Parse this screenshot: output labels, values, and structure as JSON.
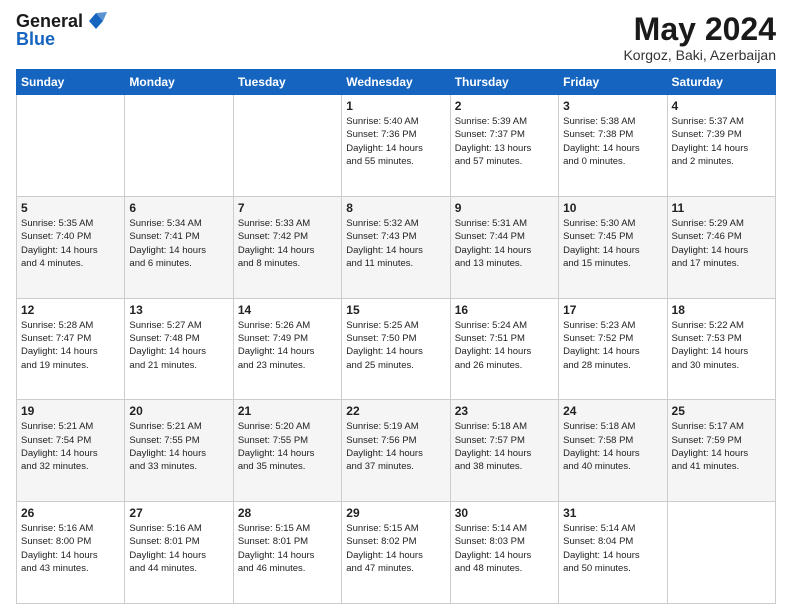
{
  "header": {
    "logo_general": "General",
    "logo_blue": "Blue",
    "month": "May 2024",
    "location": "Korgoz, Baki, Azerbaijan"
  },
  "weekdays": [
    "Sunday",
    "Monday",
    "Tuesday",
    "Wednesday",
    "Thursday",
    "Friday",
    "Saturday"
  ],
  "rows": [
    [
      {
        "day": "",
        "info": ""
      },
      {
        "day": "",
        "info": ""
      },
      {
        "day": "",
        "info": ""
      },
      {
        "day": "1",
        "info": "Sunrise: 5:40 AM\nSunset: 7:36 PM\nDaylight: 14 hours\nand 55 minutes."
      },
      {
        "day": "2",
        "info": "Sunrise: 5:39 AM\nSunset: 7:37 PM\nDaylight: 13 hours\nand 57 minutes."
      },
      {
        "day": "3",
        "info": "Sunrise: 5:38 AM\nSunset: 7:38 PM\nDaylight: 14 hours\nand 0 minutes."
      },
      {
        "day": "4",
        "info": "Sunrise: 5:37 AM\nSunset: 7:39 PM\nDaylight: 14 hours\nand 2 minutes."
      }
    ],
    [
      {
        "day": "5",
        "info": "Sunrise: 5:35 AM\nSunset: 7:40 PM\nDaylight: 14 hours\nand 4 minutes."
      },
      {
        "day": "6",
        "info": "Sunrise: 5:34 AM\nSunset: 7:41 PM\nDaylight: 14 hours\nand 6 minutes."
      },
      {
        "day": "7",
        "info": "Sunrise: 5:33 AM\nSunset: 7:42 PM\nDaylight: 14 hours\nand 8 minutes."
      },
      {
        "day": "8",
        "info": "Sunrise: 5:32 AM\nSunset: 7:43 PM\nDaylight: 14 hours\nand 11 minutes."
      },
      {
        "day": "9",
        "info": "Sunrise: 5:31 AM\nSunset: 7:44 PM\nDaylight: 14 hours\nand 13 minutes."
      },
      {
        "day": "10",
        "info": "Sunrise: 5:30 AM\nSunset: 7:45 PM\nDaylight: 14 hours\nand 15 minutes."
      },
      {
        "day": "11",
        "info": "Sunrise: 5:29 AM\nSunset: 7:46 PM\nDaylight: 14 hours\nand 17 minutes."
      }
    ],
    [
      {
        "day": "12",
        "info": "Sunrise: 5:28 AM\nSunset: 7:47 PM\nDaylight: 14 hours\nand 19 minutes."
      },
      {
        "day": "13",
        "info": "Sunrise: 5:27 AM\nSunset: 7:48 PM\nDaylight: 14 hours\nand 21 minutes."
      },
      {
        "day": "14",
        "info": "Sunrise: 5:26 AM\nSunset: 7:49 PM\nDaylight: 14 hours\nand 23 minutes."
      },
      {
        "day": "15",
        "info": "Sunrise: 5:25 AM\nSunset: 7:50 PM\nDaylight: 14 hours\nand 25 minutes."
      },
      {
        "day": "16",
        "info": "Sunrise: 5:24 AM\nSunset: 7:51 PM\nDaylight: 14 hours\nand 26 minutes."
      },
      {
        "day": "17",
        "info": "Sunrise: 5:23 AM\nSunset: 7:52 PM\nDaylight: 14 hours\nand 28 minutes."
      },
      {
        "day": "18",
        "info": "Sunrise: 5:22 AM\nSunset: 7:53 PM\nDaylight: 14 hours\nand 30 minutes."
      }
    ],
    [
      {
        "day": "19",
        "info": "Sunrise: 5:21 AM\nSunset: 7:54 PM\nDaylight: 14 hours\nand 32 minutes."
      },
      {
        "day": "20",
        "info": "Sunrise: 5:21 AM\nSunset: 7:55 PM\nDaylight: 14 hours\nand 33 minutes."
      },
      {
        "day": "21",
        "info": "Sunrise: 5:20 AM\nSunset: 7:55 PM\nDaylight: 14 hours\nand 35 minutes."
      },
      {
        "day": "22",
        "info": "Sunrise: 5:19 AM\nSunset: 7:56 PM\nDaylight: 14 hours\nand 37 minutes."
      },
      {
        "day": "23",
        "info": "Sunrise: 5:18 AM\nSunset: 7:57 PM\nDaylight: 14 hours\nand 38 minutes."
      },
      {
        "day": "24",
        "info": "Sunrise: 5:18 AM\nSunset: 7:58 PM\nDaylight: 14 hours\nand 40 minutes."
      },
      {
        "day": "25",
        "info": "Sunrise: 5:17 AM\nSunset: 7:59 PM\nDaylight: 14 hours\nand 41 minutes."
      }
    ],
    [
      {
        "day": "26",
        "info": "Sunrise: 5:16 AM\nSunset: 8:00 PM\nDaylight: 14 hours\nand 43 minutes."
      },
      {
        "day": "27",
        "info": "Sunrise: 5:16 AM\nSunset: 8:01 PM\nDaylight: 14 hours\nand 44 minutes."
      },
      {
        "day": "28",
        "info": "Sunrise: 5:15 AM\nSunset: 8:01 PM\nDaylight: 14 hours\nand 46 minutes."
      },
      {
        "day": "29",
        "info": "Sunrise: 5:15 AM\nSunset: 8:02 PM\nDaylight: 14 hours\nand 47 minutes."
      },
      {
        "day": "30",
        "info": "Sunrise: 5:14 AM\nSunset: 8:03 PM\nDaylight: 14 hours\nand 48 minutes."
      },
      {
        "day": "31",
        "info": "Sunrise: 5:14 AM\nSunset: 8:04 PM\nDaylight: 14 hours\nand 50 minutes."
      },
      {
        "day": "",
        "info": ""
      }
    ]
  ]
}
